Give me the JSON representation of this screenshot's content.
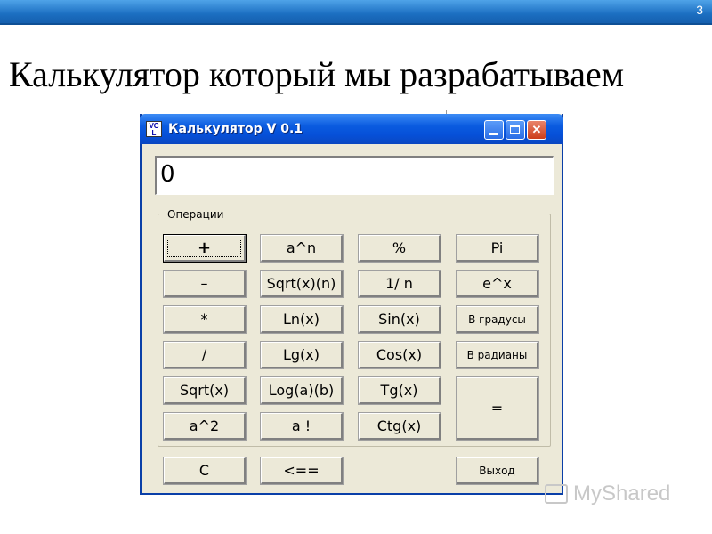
{
  "slide": {
    "number": "3",
    "title": "Калькулятор который мы разрабатываем"
  },
  "window": {
    "title": "Калькулятор V 0.1",
    "icon_letters_top": "VC",
    "icon_letters_bottom": "L",
    "minimize_icon": "minimize-icon",
    "maximize_icon": "maximize-icon",
    "close_icon": "close-icon",
    "close_glyph": "✕"
  },
  "display": {
    "value": "0"
  },
  "group": {
    "label": "Операции"
  },
  "buttons": {
    "plus": "+",
    "minus": "–",
    "multiply": "*",
    "divide": "/",
    "sqrt": "Sqrt(x)",
    "square": "a^2",
    "power": "a^n",
    "nth_root": "Sqrt(x)(n)",
    "ln": "Ln(x)",
    "lg": "Lg(x)",
    "log": "Log(a)(b)",
    "factorial": "a !",
    "percent": "%",
    "reciprocal": "1/ n",
    "sin": "Sin(x)",
    "cos": "Cos(x)",
    "tg": "Tg(x)",
    "ctg": "Ctg(x)",
    "pi": "Pi",
    "exp": "e^x",
    "to_degrees": "В градусы",
    "to_radians": "В радианы",
    "equals": "=",
    "clear": "C",
    "backspace": "<==",
    "exit": "Выход"
  },
  "watermark": {
    "text": "MyShared"
  }
}
